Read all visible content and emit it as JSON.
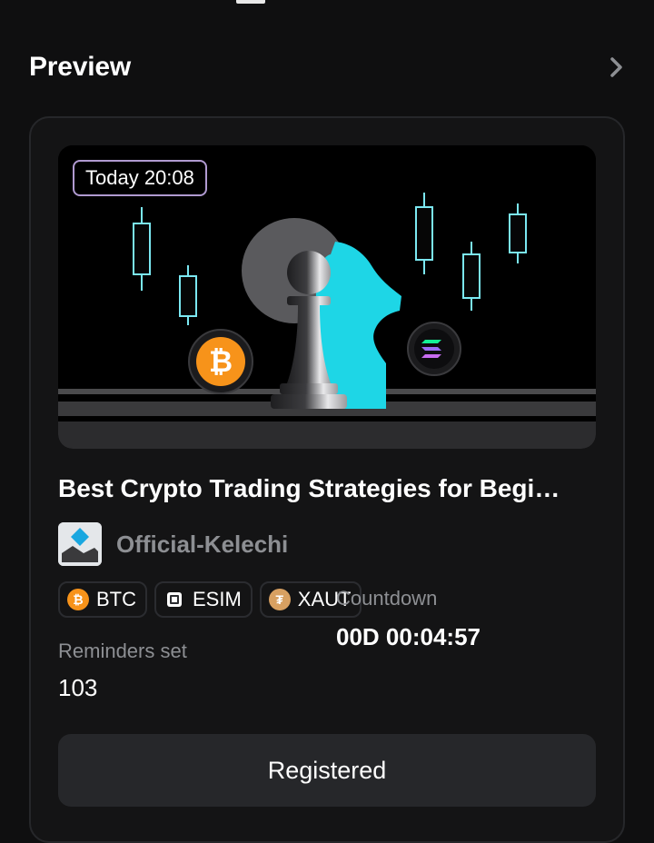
{
  "header": {
    "title": "Preview",
    "more_icon": "chevron-right-icon"
  },
  "event": {
    "time_badge": "Today 20:08",
    "title": "Best Crypto Trading Strategies for Begi…",
    "author": "Official-Kelechi",
    "tags": [
      {
        "label": "BTC",
        "icon": "bitcoin-icon",
        "color": "#f7931a"
      },
      {
        "label": "ESIM",
        "icon": "esim-icon",
        "color": "#ffffff"
      },
      {
        "label": "XAUT",
        "icon": "tether-gold-icon",
        "color": "#d8a061"
      }
    ],
    "countdown_label": "Countdown",
    "countdown_value": "00D 00:04:57",
    "reminders_label": "Reminders set",
    "reminders_value": "103",
    "button_label": "Registered"
  },
  "colors": {
    "background": "#0f0f10",
    "card": "#141415",
    "accent_cyan": "#1ed6e6",
    "badge_border": "#b09ad0",
    "muted_text": "#8d8f93",
    "button_bg": "#26272a"
  }
}
